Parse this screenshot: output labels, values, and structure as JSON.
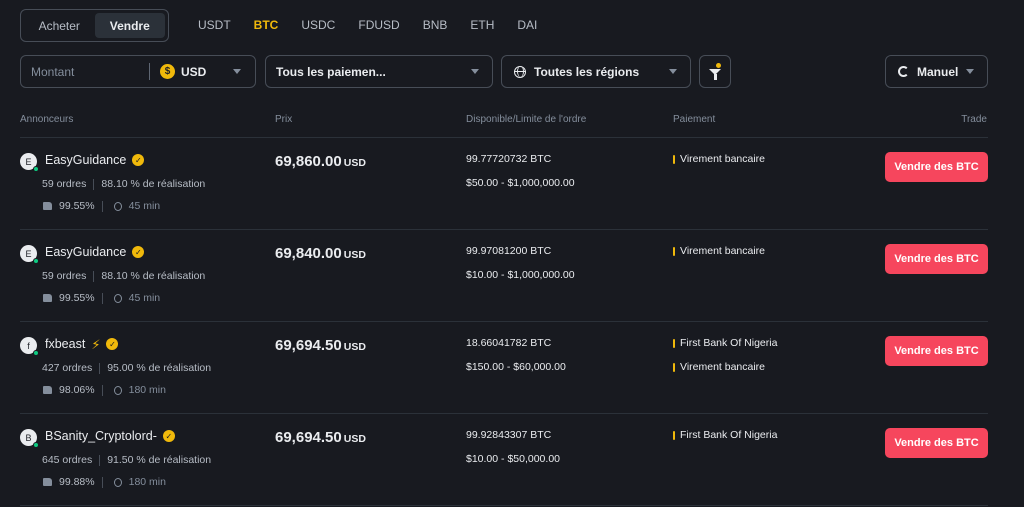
{
  "trade_toggle": {
    "buy_label": "Acheter",
    "sell_label": "Vendre"
  },
  "coin_tabs": [
    "USDT",
    "BTC",
    "USDC",
    "FDUSD",
    "BNB",
    "ETH",
    "DAI"
  ],
  "active_coin": "BTC",
  "filters": {
    "amount_placeholder": "Montant",
    "currency_symbol": "$",
    "currency": "USD",
    "payment": "Tous les paiemen...",
    "region": "Toutes les régions",
    "mode": "Manuel"
  },
  "headers": {
    "advertisers": "Annonceurs",
    "price": "Prix",
    "available": "Disponible/Limite de l'ordre",
    "payment": "Paiement",
    "trade": "Trade"
  },
  "rows": [
    {
      "avatar": "E",
      "name": "EasyGuidance",
      "bolt": false,
      "orders": "59 ordres",
      "completion": "88.10 % de réalisation",
      "rating": "99.55%",
      "time": "45 min",
      "price": "69,860.00",
      "price_unit": "USD",
      "available": "99.77720732 BTC",
      "limit": "$50.00 - $1,000,000.00",
      "payments": [
        "Virement bancaire"
      ],
      "button": "Vendre des BTC"
    },
    {
      "avatar": "E",
      "name": "EasyGuidance",
      "bolt": false,
      "orders": "59 ordres",
      "completion": "88.10 % de réalisation",
      "rating": "99.55%",
      "time": "45 min",
      "price": "69,840.00",
      "price_unit": "USD",
      "available": "99.97081200 BTC",
      "limit": "$10.00 - $1,000,000.00",
      "payments": [
        "Virement bancaire"
      ],
      "button": "Vendre des BTC"
    },
    {
      "avatar": "f",
      "name": "fxbeast",
      "bolt": true,
      "orders": "427 ordres",
      "completion": "95.00 % de réalisation",
      "rating": "98.06%",
      "time": "180 min",
      "price": "69,694.50",
      "price_unit": "USD",
      "available": "18.66041782 BTC",
      "limit": "$150.00 - $60,000.00",
      "payments": [
        "First Bank Of Nigeria",
        "Virement bancaire"
      ],
      "button": "Vendre des BTC"
    },
    {
      "avatar": "B",
      "name": "BSanity_Cryptolord-",
      "bolt": false,
      "orders": "645 ordres",
      "completion": "91.50 % de réalisation",
      "rating": "99.88%",
      "time": "180 min",
      "price": "69,694.50",
      "price_unit": "USD",
      "available": "99.92843307 BTC",
      "limit": "$10.00 - $50,000.00",
      "payments": [
        "First Bank Of Nigeria"
      ],
      "button": "Vendre des BTC"
    }
  ],
  "colors": {
    "accent": "#f0b90b",
    "sell": "#f6465d",
    "background": "#181a20",
    "online": "#0ecb81"
  }
}
